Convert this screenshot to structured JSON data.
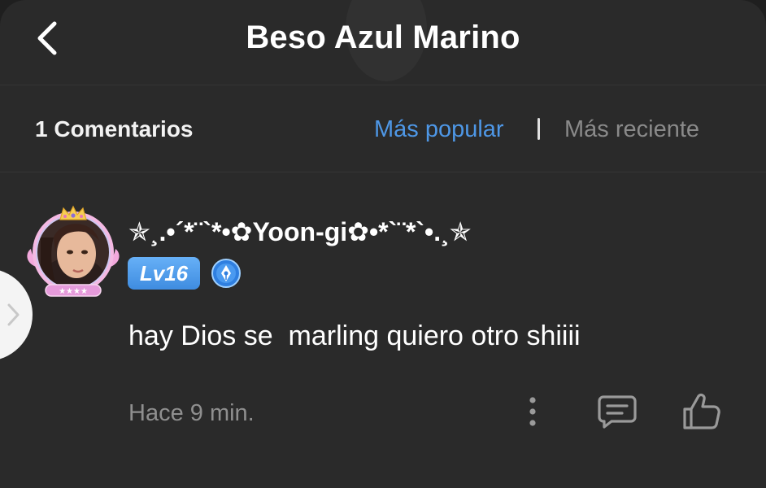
{
  "header": {
    "back_icon": "chevron-left-icon",
    "title": "Beso Azul Marino"
  },
  "comments_bar": {
    "count_label": "1 Comentarios",
    "sort_popular": "Más popular",
    "sort_recent": "Más reciente",
    "active_sort": "Más popular",
    "active_color": "#4e97e6",
    "inactive_color": "#8a8a8a"
  },
  "comment": {
    "avatar_icon": "avatar-frame-crown",
    "username": "✯¸.•´*¨`*•✿Yoon-gi✿•*`¨*`•.¸✯",
    "level": "Lv16",
    "role_icon": "pen-badge-icon",
    "text": "hay Dios se  marling quiero otro shiiii",
    "time": "Hace 9 min.",
    "actions": {
      "more_icon": "more-vertical-icon",
      "reply_icon": "comment-icon",
      "like_icon": "thumbs-up-icon"
    }
  },
  "side_handle_icon": "chevron-right-icon",
  "colors": {
    "background": "#2a2a2a",
    "accent": "#4e97e6",
    "level_badge": "#4a96e8"
  }
}
